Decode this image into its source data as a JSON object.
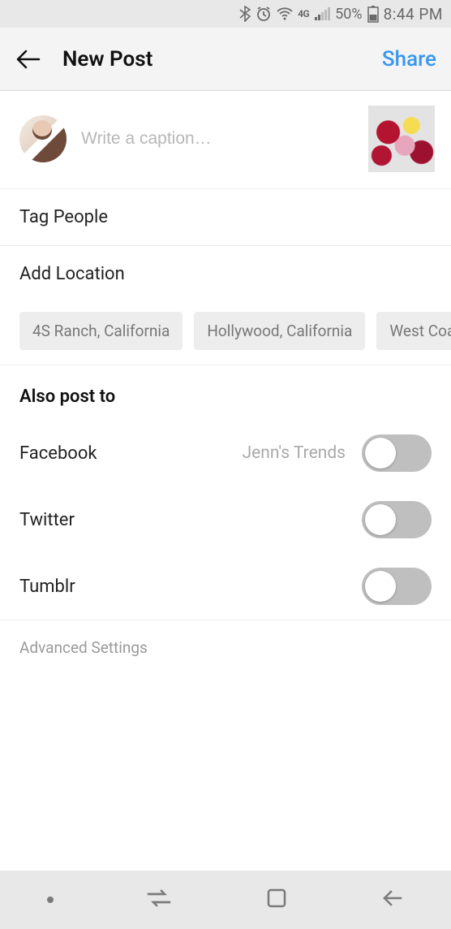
{
  "status": {
    "battery_pct": "50%",
    "time": "8:44 PM",
    "network": "4G"
  },
  "header": {
    "title": "New Post",
    "share_label": "Share"
  },
  "caption": {
    "placeholder": "Write a caption…",
    "value": ""
  },
  "rows": {
    "tag_people": "Tag People",
    "add_location": "Add Location"
  },
  "location_suggestions": [
    "4S Ranch, California",
    "Hollywood, California",
    "West Coast M"
  ],
  "also_post": {
    "header": "Also post to",
    "options": [
      {
        "name": "Facebook",
        "account": "Jenn's Trends",
        "on": false
      },
      {
        "name": "Twitter",
        "account": "",
        "on": false
      },
      {
        "name": "Tumblr",
        "account": "",
        "on": false
      }
    ]
  },
  "advanced_label": "Advanced Settings"
}
